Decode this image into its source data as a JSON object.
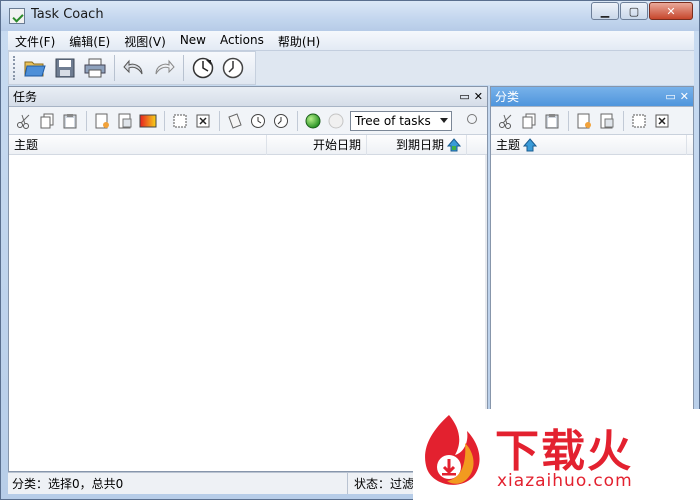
{
  "window": {
    "title": "Task Coach"
  },
  "menu": [
    "文件(F)",
    "编辑(E)",
    "视图(V)",
    "New",
    "Actions",
    "帮助(H)"
  ],
  "tasks_panel": {
    "title": "任务",
    "view_select": "Tree of tasks",
    "columns": [
      "主题",
      "开始日期",
      "到期日期"
    ]
  },
  "categories_panel": {
    "title": "分类",
    "columns": [
      "主题"
    ]
  },
  "status": {
    "left": "分类：选择0，总共0",
    "right": "状态：过滤"
  },
  "watermark": {
    "cn": "下载火",
    "en": "xiazaihuo.com"
  },
  "colors": {
    "active_panel": "#5a9fe0",
    "watermark": "#e3212f"
  }
}
